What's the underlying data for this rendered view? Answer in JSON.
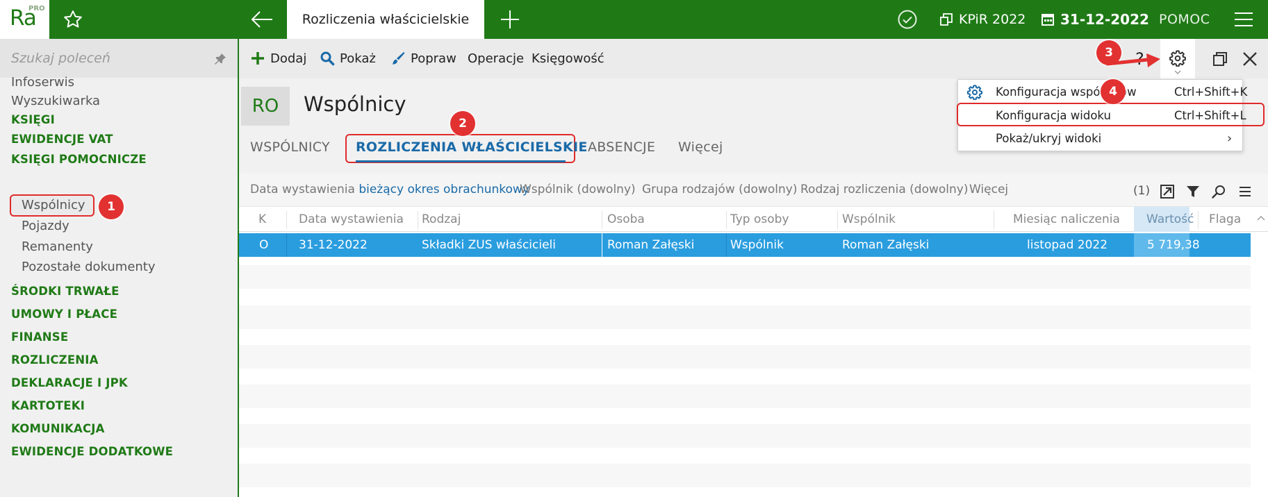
{
  "topbar": {
    "logo": "Ra",
    "logo_badge": "PRO",
    "active_tab": "Rozliczenia właścicielskie",
    "kpir": "KPiR 2022",
    "date": "31-12-2022",
    "help": "POMOC"
  },
  "sidebar": {
    "search_placeholder": "Szukaj poleceń",
    "top_items": [
      "Infoserwis",
      "Wyszukiwarka"
    ],
    "sections": {
      "ksiegi": "KSIĘGI",
      "ewidencje_vat": "EWIDENCJE VAT",
      "ksiegi_pomocnicze": "KSIĘGI POMOCNICZE",
      "srodki_trwale": "ŚRODKI TRWAŁE",
      "umowy": "UMOWY I PŁACE",
      "finanse": "FINANSE",
      "rozliczenia": "ROZLICZENIA",
      "deklaracje": "DEKLARACJE I JPK",
      "kartoteki": "KARTOTEKI",
      "komunikacja": "KOMUNIKACJA",
      "ewidencje_dodatkowe": "EWIDENCJE DODATKOWE"
    },
    "sub_items": [
      "Wspólnicy",
      "Pojazdy",
      "Remanenty",
      "Pozostałe dokumenty"
    ]
  },
  "toolbar": {
    "add": "Dodaj",
    "show": "Pokaż",
    "edit": "Popraw",
    "operations": "Operacje",
    "accounting": "Księgowość",
    "help": "?"
  },
  "header": {
    "badge": "RO",
    "title": "Wspólnicy"
  },
  "tabs": {
    "partners": "WSPÓLNICY",
    "settlements": "ROZLICZENIA WŁAŚCICIELSKIE",
    "absences": "ABSENCJE",
    "more": "Więcej"
  },
  "filters": {
    "date_label": "Data wystawienia",
    "date_value": "bieżący okres obrachunkowy",
    "partner": "Wspólnik (dowolny)",
    "group": "Grupa rodzajów (dowolny)",
    "type": "Rodzaj rozliczenia (dowolny)",
    "more": "Więcej",
    "count": "(1)"
  },
  "grid": {
    "columns": [
      "K",
      "Data wystawienia",
      "Rodzaj",
      "Osoba",
      "Typ osoby",
      "Wspólnik",
      "Miesiąc naliczenia",
      "Wartość",
      "Flaga"
    ],
    "rows": [
      [
        "O",
        "31-12-2022",
        "Składki ZUS właścicieli",
        "Roman Załęski",
        "Wspólnik",
        "Roman Załęski",
        "listopad 2022",
        "5 719,38",
        ""
      ]
    ]
  },
  "dropdown": {
    "items": [
      {
        "label": "Konfiguracja wspólników",
        "shortcut": "Ctrl+Shift+K"
      },
      {
        "label": "Konfiguracja widoku",
        "shortcut": "Ctrl+Shift+L"
      },
      {
        "label": "Pokaż/ukryj widoki",
        "shortcut": ""
      }
    ]
  },
  "annotations": [
    "1",
    "2",
    "3",
    "4"
  ],
  "colors": {
    "brand_green": "#1f7a16",
    "selection_blue": "#2a9ddf",
    "accent_blue": "#1a6aa8",
    "annotation_red": "#e23131"
  },
  "icons": [
    "star-icon",
    "back-arrow-icon",
    "plus-icon",
    "check-circle-icon",
    "copy-icon",
    "calendar-icon",
    "hamburger-icon",
    "pin-icon",
    "search-icon",
    "brush-icon",
    "gear-icon",
    "restore-window-icon",
    "close-icon",
    "export-icon",
    "filter-icon",
    "magnifier-icon",
    "menu-lines-icon"
  ]
}
